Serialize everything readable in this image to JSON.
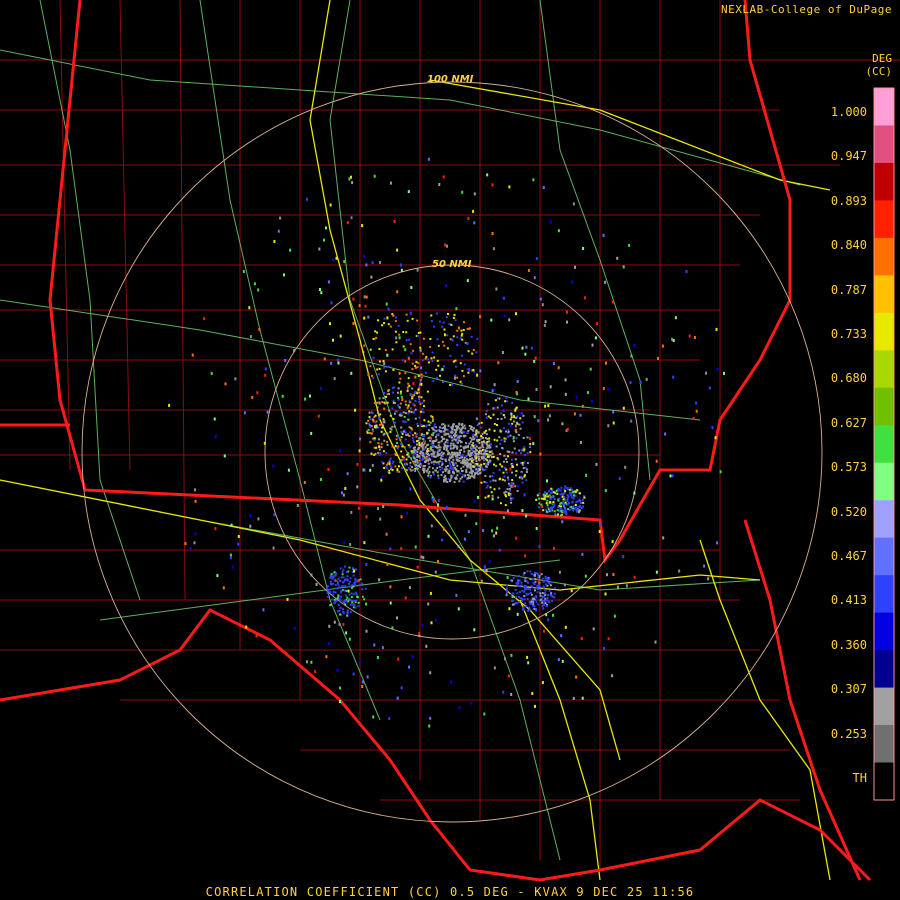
{
  "credit": "NEXLAB-College of DuPage",
  "units": {
    "line1": "DEG",
    "line2": "(CC)"
  },
  "range_rings": [
    {
      "label": "100 NMI"
    },
    {
      "label": "50 NMI"
    }
  ],
  "legend": {
    "ticks": [
      "1.000",
      "0.947",
      "0.893",
      "0.840",
      "0.787",
      "0.733",
      "0.680",
      "0.627",
      "0.573",
      "0.520",
      "0.467",
      "0.413",
      "0.360",
      "0.307",
      "0.253",
      "TH"
    ],
    "colors": [
      "#ff9fd8",
      "#e05080",
      "#c00000",
      "#ff2000",
      "#ff7000",
      "#ffc000",
      "#e8e800",
      "#a8d800",
      "#70c000",
      "#40e040",
      "#80ff80",
      "#a0a0ff",
      "#6070ff",
      "#3040ff",
      "#0000e0",
      "#000090",
      "#a0a0a0",
      "#707070",
      "#000000"
    ]
  },
  "caption": "CORRELATION COEFFICIENT (CC) 0.5 DEG - KVAX 9 DEC 25 11:56"
}
